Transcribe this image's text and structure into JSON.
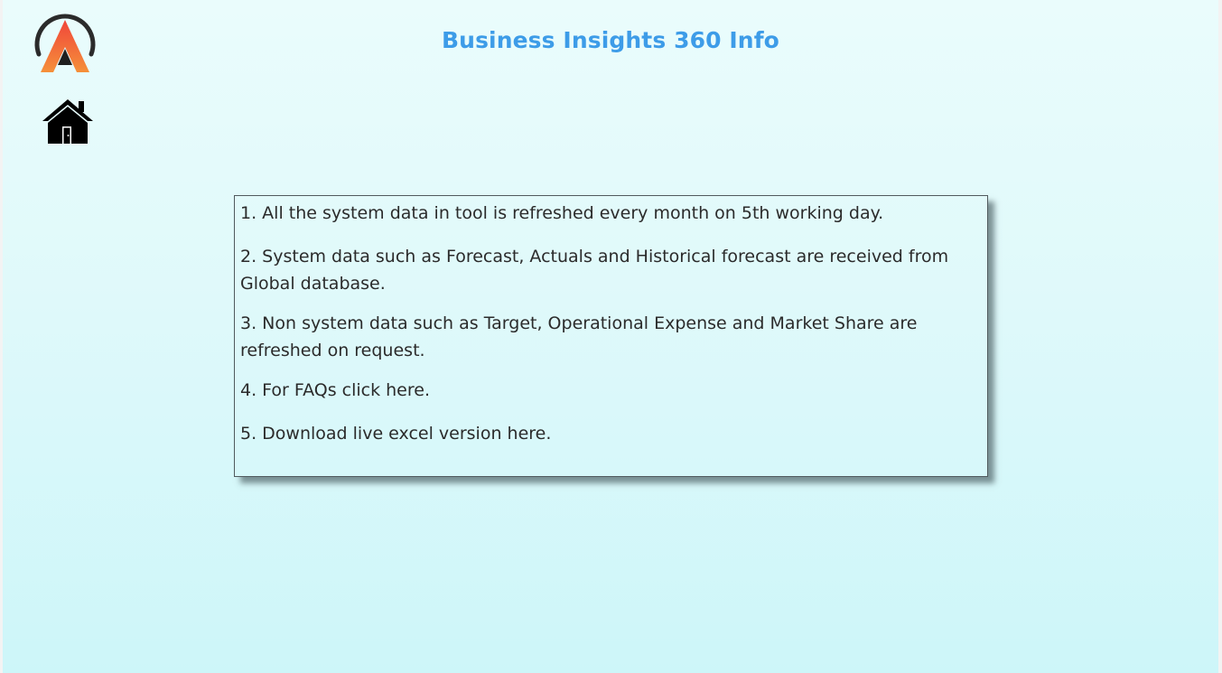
{
  "header": {
    "title": "Business Insights 360 Info"
  },
  "colors": {
    "title": "#3d9ce8",
    "logo_gradient_top": "#f25a3c",
    "logo_gradient_bottom": "#f58a2b",
    "logo_ring": "#2b2b2b",
    "home_icon": "#000000"
  },
  "icons": {
    "logo": "brand-logo-icon",
    "home": "home-icon"
  },
  "info": {
    "items": [
      "1. All the system data in tool is refreshed every month on 5th working day.",
      "2.  System data such as Forecast, Actuals and Historical forecast are received from Global database.",
      "3.  Non system data such as Target, Operational Expense and Market Share are refreshed on request.",
      "4. For FAQs click here.",
      "5. Download live excel version here."
    ]
  }
}
